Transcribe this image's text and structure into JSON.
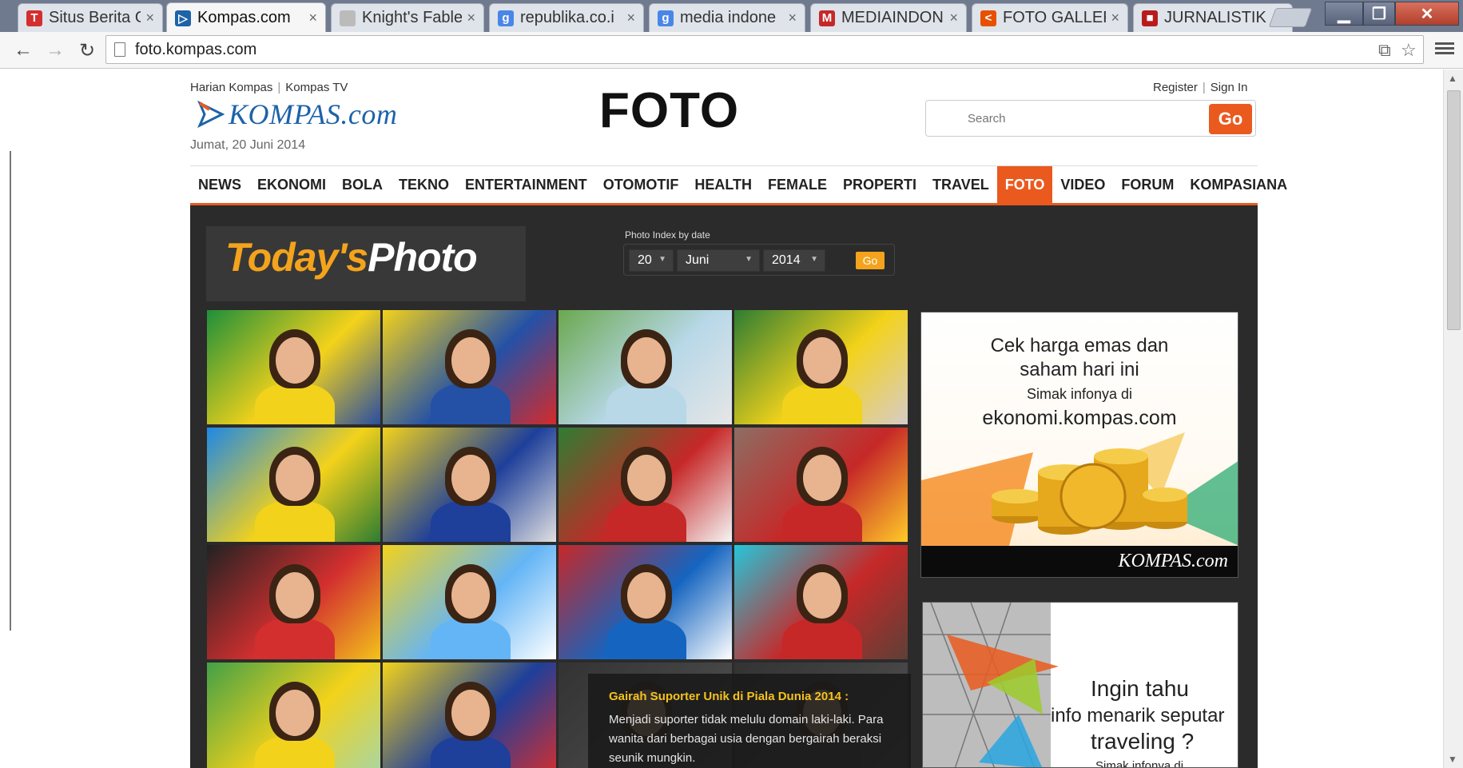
{
  "browser": {
    "tabs": [
      {
        "label": "Situs Berita O",
        "icon": "tempo-favicon-icon",
        "color": "#d32f2f",
        "glyph": "T"
      },
      {
        "label": "Kompas.com",
        "icon": "kompas-favicon-icon",
        "color": "#1d63a8",
        "glyph": "▷",
        "active": true
      },
      {
        "label": "Knight's Fable",
        "icon": "page-favicon-icon",
        "color": "#bbbbbb",
        "glyph": ""
      },
      {
        "label": "republika.co.i",
        "icon": "google-favicon-icon",
        "color": "#4a86e8",
        "glyph": "g"
      },
      {
        "label": "media indone",
        "icon": "google-favicon-icon",
        "color": "#4a86e8",
        "glyph": "g"
      },
      {
        "label": "MEDIAINDON",
        "icon": "mi-favicon-icon",
        "color": "#c62828",
        "glyph": "M"
      },
      {
        "label": "FOTO GALLER",
        "icon": "share-favicon-icon",
        "color": "#e65100",
        "glyph": "<"
      },
      {
        "label": "JURNALISTIK",
        "icon": "blog-favicon-icon",
        "color": "#b71c1c",
        "glyph": "■"
      }
    ],
    "close_glyph": "×",
    "url": "foto.kompas.com"
  },
  "site": {
    "toplinks": [
      "Harian Kompas",
      "Kompas TV"
    ],
    "userlinks": [
      "Register",
      "Sign In"
    ],
    "logo_text": "KOMPAS.com",
    "date": "Jumat, 20 Juni 2014",
    "page_title": "FOTO",
    "search_placeholder": "Search",
    "search_go": "Go",
    "accent": "#ea5a1f"
  },
  "nav": [
    "NEWS",
    "EKONOMI",
    "BOLA",
    "TEKNO",
    "ENTERTAINMENT",
    "OTOMOTIF",
    "HEALTH",
    "FEMALE",
    "PROPERTI",
    "TRAVEL",
    "FOTO",
    "VIDEO",
    "FORUM",
    "KOMPASIANA"
  ],
  "nav_active": "FOTO",
  "todays": {
    "part1": "Today's",
    "part2": "Photo"
  },
  "photo_index": {
    "label": "Photo Index by date",
    "day": "20",
    "month": "Juni",
    "year": "2014",
    "go": "Go"
  },
  "caption": {
    "title": "Gairah Suporter Unik di Piala Dunia 2014 :",
    "text": "Menjadi suporter tidak melulu domain laki-laki. Para wanita dari berbagai usia dengan bergairah beraksi seunik mungkin."
  },
  "ads": {
    "gold": {
      "line1": "Cek harga emas dan",
      "line2": "saham hari ini",
      "line3": "Simak infonya di",
      "line4": "ekonomi.kompas.com",
      "brand": "KOMPAS.com"
    },
    "travel": {
      "line1": "Ingin tahu",
      "line2": "info menarik seputar",
      "line3": "traveling ?",
      "line4": "Simak infonya di"
    }
  }
}
